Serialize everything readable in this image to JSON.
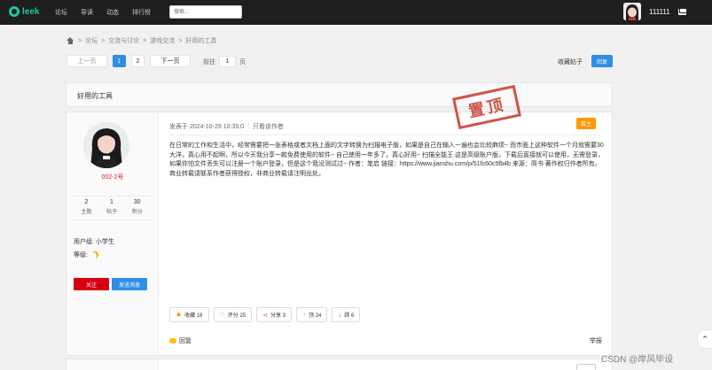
{
  "header": {
    "logo_text": "leek",
    "nav": [
      "论坛",
      "导读",
      "动态",
      "排行榜"
    ],
    "search_placeholder": "搜索...",
    "username": "111111"
  },
  "breadcrumb": [
    "论坛",
    "交流与讨论",
    "游戏交流",
    "好用的工具"
  ],
  "pagination": {
    "prev": "上一页",
    "pages": [
      "1",
      "2"
    ],
    "current": "1",
    "next": "下一页",
    "goto_label": "前往",
    "goto_value": "1",
    "goto_unit": "页"
  },
  "toolbar": {
    "collect_label": "收藏帖子",
    "reply_label": "回复"
  },
  "thread": {
    "title": "好用的工具"
  },
  "post": {
    "author": "002-2号",
    "stats": [
      {
        "value": "2",
        "label": "主题"
      },
      {
        "value": "1",
        "label": "帖子"
      },
      {
        "value": "30",
        "label": "积分"
      }
    ],
    "user_group_label": "用户组:",
    "user_group_value": "小学生",
    "level_label": "等级:",
    "follow_label": "关注",
    "message_label": "发送消息",
    "posted_at": "发表于 2024-10-29 10:35:0",
    "meta_sep": "|",
    "only_author": "只看该作者",
    "floor_badge": "楼主",
    "stamp_text": "置顶",
    "content": "在日常的工作和生活中，经常需要把一张表格或者文档上面的文字转换为扫描电子版，如果是自己在输入一遍也会比较麻烦~ 而市面上这种软件一个月就需要30大洋，真心用不起啊，所以今天我分享一款免费使用的软件~ 自己使用一年多了，真心好用~ 扫描全能王 这是高级账户版，下载后直接就可以使用，无需登录，如果你怕文件丢失可以注册一个账户登录，但是这个我没测试过~ 作者：笔启 链接：https://www.jianshu.com/p/51fc60c5fb4b 来源：简书 著作权归作者所有。商业转载请联系作者获得授权，非商业转载请注明出处。",
    "actions": [
      {
        "icon": "star-icon",
        "label": "收藏 16"
      },
      {
        "icon": "thumb-icon",
        "label": "评分 25"
      },
      {
        "icon": "share-icon",
        "label": "分享 3"
      },
      {
        "icon": "up-arrow-icon",
        "label": "顶 24"
      },
      {
        "icon": "down-arrow-icon",
        "label": "踩 6"
      }
    ],
    "reply_link": "回复",
    "report_link": "举报"
  },
  "watermark": "CSDN @岸风毕设",
  "colors": {
    "topbar": "#1e1e1e",
    "accent": "#2f8ee6",
    "follow": "#d7000f",
    "badge": "#ff9800",
    "stamp": "#c9372b"
  }
}
